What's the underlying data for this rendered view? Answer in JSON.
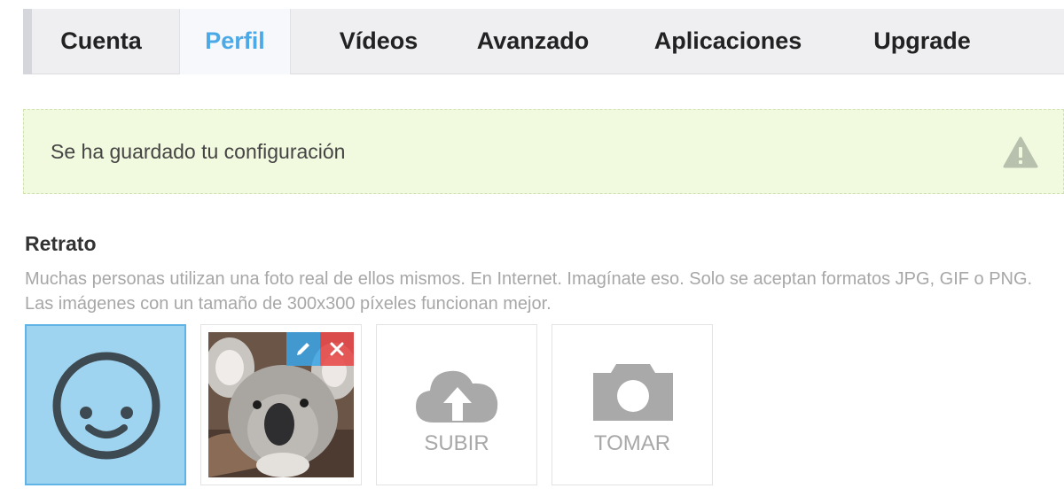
{
  "tabs": [
    {
      "label": "Cuenta",
      "active": false
    },
    {
      "label": "Perfil",
      "active": true
    },
    {
      "label": "Vídeos",
      "active": false
    },
    {
      "label": "Avanzado",
      "active": false
    },
    {
      "label": "Aplicaciones",
      "active": false
    },
    {
      "label": "Upgrade",
      "active": false
    }
  ],
  "alert": {
    "message": "Se ha guardado tu configuración",
    "icon": "warning-icon"
  },
  "portrait": {
    "heading": "Retrato",
    "description": "Muchas personas utilizan una foto real de ellos mismos. En Internet. Imagínate eso. Solo se aceptan formatos JPG, GIF o PNG. Las imágenes con un tamaño de 300x300 píxeles funcionan mejor.",
    "options": {
      "default_avatar": {
        "icon": "smiley-face-icon",
        "selected": true
      },
      "photo": {
        "icon": "koala-photo",
        "edit_icon": "pencil-icon",
        "delete_icon": "close-icon"
      },
      "upload": {
        "label": "SUBIR",
        "icon": "cloud-upload-icon"
      },
      "capture": {
        "label": "TOMAR",
        "icon": "camera-icon"
      }
    }
  },
  "colors": {
    "active_tab": "#4aa9e6",
    "alert_background": "#f1f9de",
    "selected_tile": "#9fd4f1",
    "edit_button": "#3aa6e8",
    "delete_button": "#e54b4b"
  }
}
